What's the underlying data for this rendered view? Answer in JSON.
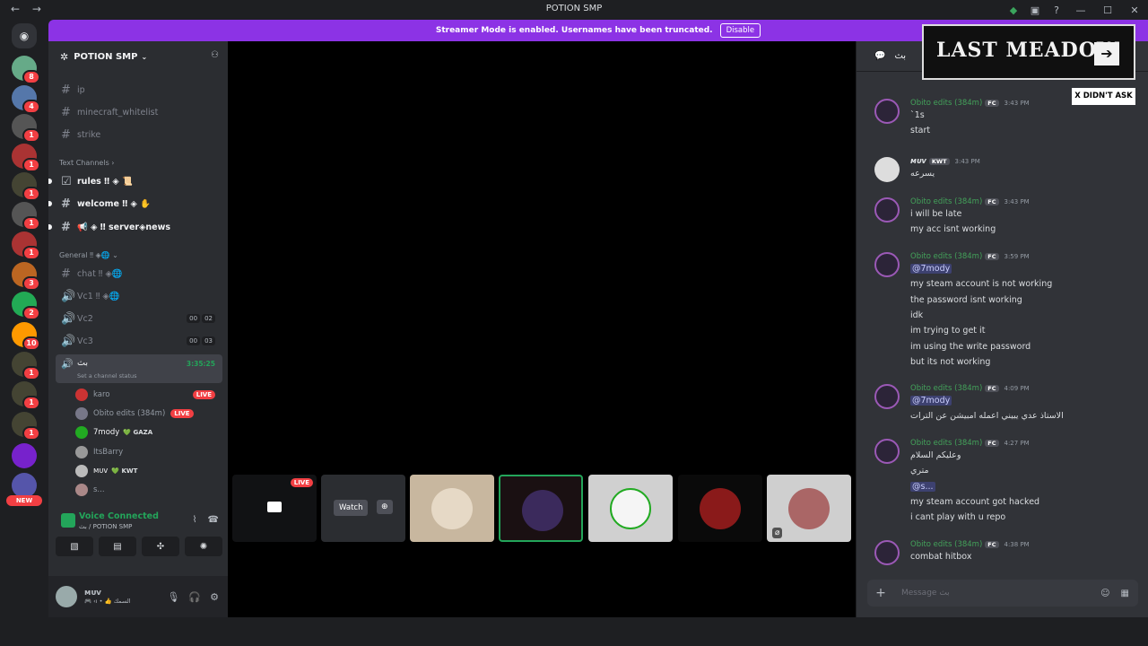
{
  "window": {
    "title": "POTION SMP"
  },
  "banner": {
    "text": "Streamer Mode is enabled. Usernames have been truncated.",
    "button": "Disable"
  },
  "guilds": [
    {
      "badge": "8",
      "color": "#6a8"
    },
    {
      "badge": "4",
      "color": "#57a"
    },
    {
      "badge": "1",
      "color": "#555"
    },
    {
      "badge": "1",
      "color": "#a33"
    },
    {
      "badge": "1",
      "color": "#443"
    },
    {
      "badge": "1",
      "color": "#555"
    },
    {
      "badge": "1",
      "color": "#a33"
    },
    {
      "badge": "3",
      "color": "#b62"
    },
    {
      "badge": "2",
      "color": "#2a5"
    },
    {
      "badge": "10",
      "color": "#f90"
    },
    {
      "badge": "1",
      "color": "#443"
    },
    {
      "badge": "1",
      "color": "#443"
    },
    {
      "badge": "1",
      "color": "#443"
    },
    {
      "badge": "",
      "color": "#72c"
    },
    {
      "badge": "",
      "color": "#55a"
    }
  ],
  "new_pill": "NEW",
  "server": {
    "name": "POTION SMP"
  },
  "channels_top": [
    {
      "label": "ip"
    },
    {
      "label": "minecraft_whitelist"
    },
    {
      "label": "strike"
    }
  ],
  "cat_text": "Text Channels",
  "text_channels": [
    {
      "label": "rules ‼ ◈ 📜"
    },
    {
      "label": "welcome ‼ ◈ ✋"
    },
    {
      "label": "📢 ◈ ‼ server◈news"
    }
  ],
  "cat_general": "General ‼ ◈🌐",
  "general_channels": [
    {
      "label": "chat ‼ ◈🌐"
    },
    {
      "label": "Vc1 ‼ ◈🌐"
    },
    {
      "label": "Vc2",
      "c1": "00",
      "c2": "02"
    },
    {
      "label": "Vc3",
      "c1": "00",
      "c2": "03"
    }
  ],
  "active_voice": {
    "label": "بث",
    "timer": "3:35:25",
    "status": "Set a channel status"
  },
  "voice_users": [
    {
      "name": "karo",
      "live": "LIVE",
      "color": "#c33"
    },
    {
      "name": "Obito edits (384m)",
      "live": "LIVE",
      "color": "#778"
    },
    {
      "name": "7mody",
      "extra": "💚 GAZA",
      "color": "#2a2"
    },
    {
      "name": "ItsBarry",
      "color": "#999"
    },
    {
      "name": "ᴍᴜᴠ",
      "extra": "💚 KWT",
      "color": "#bbb"
    },
    {
      "name": "s...",
      "color": "#a88"
    }
  ],
  "voice_connected": {
    "title": "Voice Connected",
    "sub": "بث / POTION SMP"
  },
  "user_panel": {
    "name": "ᴍᴜᴠ",
    "status": "🎮 ‹ı • 👍 السمك"
  },
  "stage": {
    "live": "LIVE",
    "watch": "Watch"
  },
  "chat": {
    "channel": "بث",
    "composer_placeholder": "Message بث",
    "messages": [
      {
        "user": "Obito edits (384m)",
        "tag": "FC",
        "time": "3:43 PM",
        "lines": [
          "`1s",
          "start"
        ]
      },
      {
        "user": "ᴍᴜᴠ",
        "tag": "KWT",
        "time": "3:43 PM",
        "lines": [
          "يسرعه"
        ]
      },
      {
        "user": "Obito edits (384m)",
        "tag": "FC",
        "time": "3:43 PM",
        "lines": [
          "i will be late",
          "my acc isnt working"
        ]
      },
      {
        "user": "Obito edits (384m)",
        "tag": "FC",
        "time": "3:59 PM",
        "lines": [
          "@7mody",
          "my steam account is not working",
          "the password isnt working",
          "idk",
          "im trying to get it",
          "im using the write password",
          "but its not working"
        ]
      },
      {
        "user": "Obito edits (384m)",
        "tag": "FC",
        "time": "4:09 PM",
        "lines": [
          "@7mody",
          "الاستاذ عدي يبيني اعمله امبيشن عن الترات"
        ]
      },
      {
        "user": "Obito edits (384m)",
        "tag": "FC",
        "time": "4:27 PM",
        "lines": [
          "وعليكم السلام",
          "متري",
          "@s...",
          "my steam account got hacked",
          "i cant play with u repo"
        ]
      },
      {
        "user": "Obito edits (384m)",
        "tag": "FC",
        "time": "4:38 PM",
        "lines": [
          "combat hitbox"
        ]
      }
    ]
  },
  "overlay": {
    "brand": "LAST MEADOW",
    "note": "X DIDN'T ASK"
  }
}
